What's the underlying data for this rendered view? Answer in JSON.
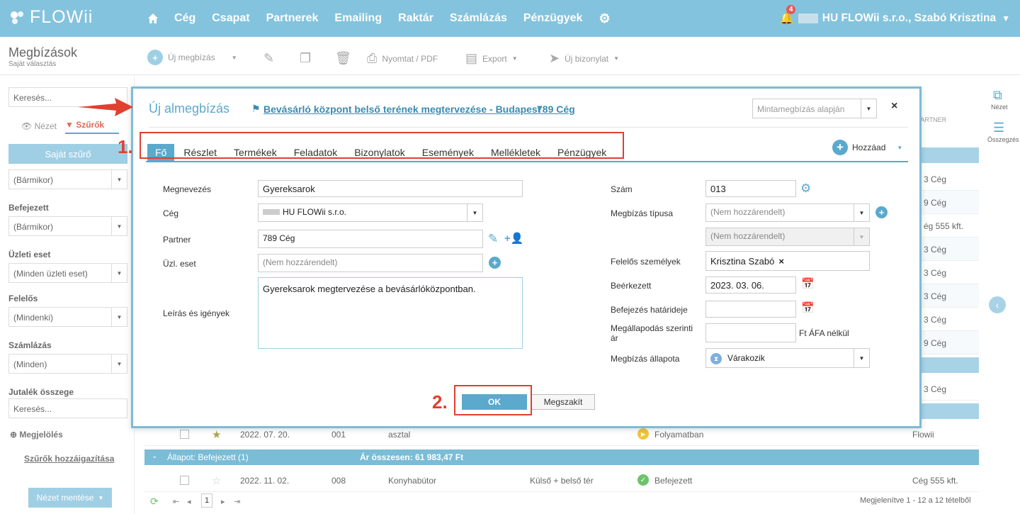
{
  "app": {
    "logo": "FLOWii",
    "nav": [
      "Cég",
      "Csapat",
      "Partnerek",
      "Emailing",
      "Raktár",
      "Számlázás",
      "Pénzügyek"
    ],
    "notif_count": "4",
    "user": "HU FLOWii s.r.o., Szabó Krisztina"
  },
  "page": {
    "title": "Megbízások",
    "subtitle": "Saját választás"
  },
  "toolbar": {
    "new": "Új megbízás",
    "print": "Nyomtat / PDF",
    "export": "Export",
    "new_doc": "Új bizonylat"
  },
  "sidebar": {
    "search_placeholder": "Keresés...",
    "view_tab": "Nézet",
    "filter_tab": "Szűrők",
    "own_filter": "Saját szűrő",
    "f0": "(Bármikor)",
    "lbl1": "Befejezett",
    "f1": "(Bármikor)",
    "lbl2": "Üzleti eset",
    "f2": "(Minden üzleti eset)",
    "lbl3": "Felelős",
    "f3": "(Mindenki)",
    "lbl4": "Számlázás",
    "f4": "(Minden)",
    "lbl5": "Jutalék összege",
    "f5_placeholder": "Keresés...",
    "mark": "Megjelölés",
    "assign": "Szűrők hozzáigazítása",
    "save_view": "Nézet mentése"
  },
  "right": {
    "view": "Nézet",
    "summary": "Összegzés"
  },
  "table": {
    "partner_header": "PARTNER",
    "partners": [
      "3 Cég",
      "9 Cég",
      "ég 555 kft.",
      "3 Cég",
      "3 Cég",
      "3 Cég",
      "3 Cég",
      "9 Cég",
      "3 Cég"
    ],
    "row_a": {
      "date": "2022. 07. 20.",
      "num": "001",
      "name": "asztal",
      "status": "Folyamatban",
      "partner": "Flowii"
    },
    "group": {
      "label": "Állapot: Befejezett (1)",
      "sum": "Ár összesen: 61 983,47 Ft"
    },
    "row_b": {
      "date": "2022. 11. 02.",
      "num": "008",
      "name": "Konyhabútor",
      "extra": "Külső + belső tér",
      "status": "Befejezett",
      "partner": "Cég 555 kft."
    },
    "page": "1",
    "footer": "Megjelenítve 1 - 12 a 12 tételből"
  },
  "modal": {
    "title": "Új almegbízás",
    "parent_link": "Bevásárló központ belső terének megtervezése - Budapest",
    "partner_link": "789 Cég",
    "template_placeholder": "Mintamegbízás alapján",
    "close": "×",
    "tabs": [
      "Fő",
      "Részlet",
      "Termékek",
      "Feladatok",
      "Bizonylatok",
      "Események",
      "Mellékletek",
      "Pénzügyek"
    ],
    "add": "Hozzáad",
    "left": {
      "name_lbl": "Megnevezés",
      "name": "Gyereksarok",
      "company_lbl": "Cég",
      "company": "HU FLOWii s.r.o.",
      "partner_lbl": "Partner",
      "partner": "789 Cég",
      "case_lbl": "Üzl. eset",
      "case_placeholder": "(Nem hozzárendelt)",
      "desc_lbl": "Leírás és igények",
      "desc": "Gyereksarok megtervezése a bevásárlóközpontban."
    },
    "right": {
      "num_lbl": "Szám",
      "num": "013",
      "type_lbl": "Megbízás típusa",
      "type": "(Nem hozzárendelt)",
      "subtype": "(Nem hozzárendelt)",
      "resp_lbl": "Felelős személyek",
      "resp": "Krisztina Szabó",
      "recv_lbl": "Beérkezett",
      "recv": "2023. 03. 06.",
      "deadline_lbl": "Befejezés határideje",
      "price_lbl": "Megállapodás szerinti ár",
      "price_unit": "Ft ÁFA nélkül",
      "status_lbl": "Megbízás állapota",
      "status": "Várakozik"
    },
    "ok": "OK",
    "cancel": "Megszakít"
  },
  "annotations": {
    "step1": "1.",
    "step2": "2."
  },
  "colors": {
    "accent": "#5ba9cc",
    "topbar": "#84c3dd",
    "highlight": "#e04030"
  }
}
